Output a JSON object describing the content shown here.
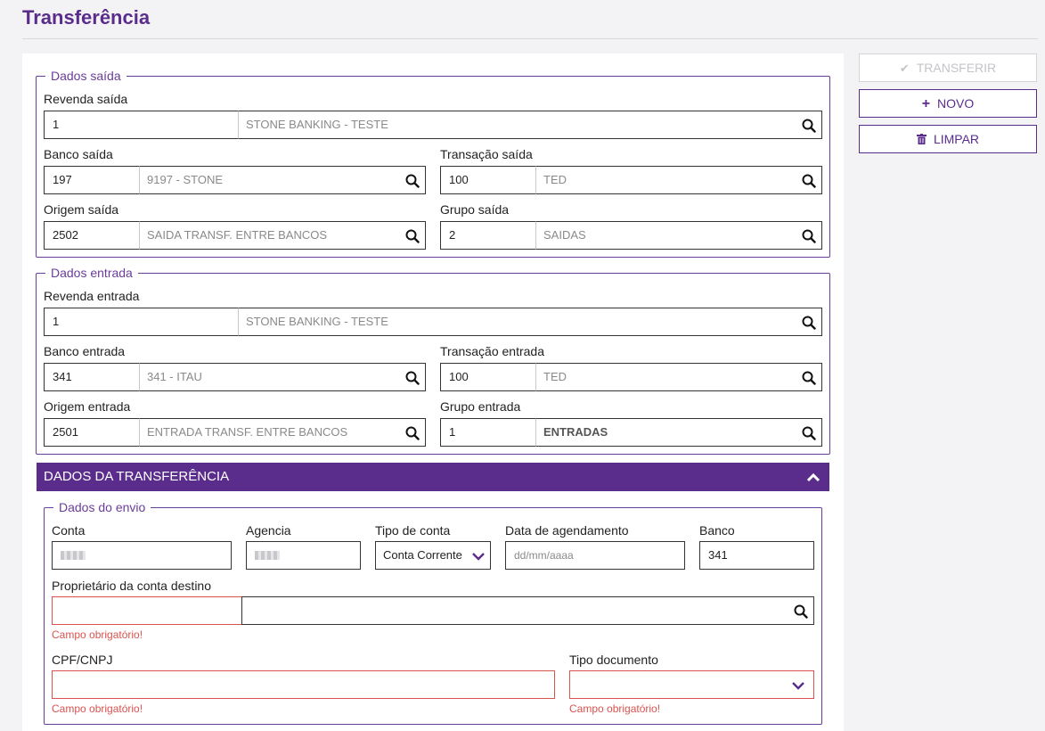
{
  "page": {
    "title": "Transferência"
  },
  "actions": {
    "transfer_label": "TRANSFERIR",
    "new_label": "NOVO",
    "clear_label": "LIMPAR"
  },
  "saida": {
    "legend": "Dados saída",
    "revenda": {
      "label": "Revenda saída",
      "code": "1",
      "desc": "STONE BANKING - TESTE"
    },
    "banco": {
      "label": "Banco saída",
      "code": "197",
      "desc": "9197 - STONE"
    },
    "transacao": {
      "label": "Transação saída",
      "code": "100",
      "desc": "TED"
    },
    "origem": {
      "label": "Origem saída",
      "code": "2502",
      "desc": "SAIDA TRANSF. ENTRE BANCOS"
    },
    "grupo": {
      "label": "Grupo saída",
      "code": "2",
      "desc": "SAIDAS"
    }
  },
  "entrada": {
    "legend": "Dados entrada",
    "revenda": {
      "label": "Revenda entrada",
      "code": "1",
      "desc": "STONE BANKING - TESTE"
    },
    "banco": {
      "label": "Banco entrada",
      "code": "341",
      "desc": "341 - ITAU"
    },
    "transacao": {
      "label": "Transação entrada",
      "code": "100",
      "desc": "TED"
    },
    "origem": {
      "label": "Origem entrada",
      "code": "2501",
      "desc": "ENTRADA TRANSF. ENTRE BANCOS"
    },
    "grupo": {
      "label": "Grupo entrada",
      "code": "1",
      "desc": "ENTRADAS"
    }
  },
  "transferencia": {
    "header": "DADOS DA TRANSFERÊNCIA",
    "envio": {
      "legend": "Dados do envio",
      "conta_label": "Conta",
      "agencia_label": "Agencia",
      "tipo_conta_label": "Tipo de conta",
      "tipo_conta_value": "Conta Corrente",
      "data_label": "Data de agendamento",
      "data_placeholder": "dd/mm/aaaa",
      "banco_label": "Banco",
      "banco_value": "341",
      "proprietario_label": "Proprietário da conta destino",
      "cpf_label": "CPF/CNPJ",
      "tipo_doc_label": "Tipo documento",
      "required_msg": "Campo obrigatório!"
    }
  },
  "colors": {
    "primary": "#5a2d8c",
    "border": "#6a3d9a",
    "error": "#d9534f"
  }
}
